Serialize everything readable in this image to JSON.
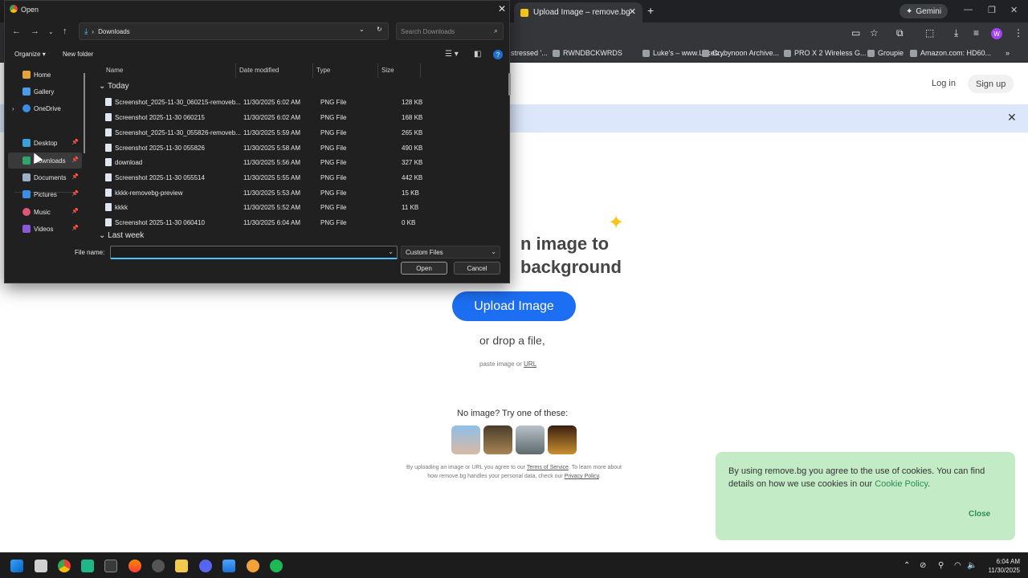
{
  "browser": {
    "tab_title": "Upload Image – remove.bg",
    "new_tab": "+",
    "gemini": "Gemini",
    "bookmarks": [
      "stressed '...",
      "RWNDBCKWRDS",
      "Luke's – www.Lukes....",
      "Crybynoon Archive...",
      "PRO X 2 Wireless G...",
      "Groupie",
      "Amazon.com: HD60..."
    ]
  },
  "page": {
    "login": "Log in",
    "signup": "Sign up",
    "hero_line1": "n image to",
    "hero_line2": "background",
    "upload_button": "Upload Image",
    "drop_text": "or drop a file,",
    "paste_text": "paste image or",
    "paste_link": "URL",
    "no_image_text": "No image? Try one of these:",
    "legal_prefix": "By uploading an image or URL you agree to our",
    "terms_link": "Terms of Service",
    "legal_mid": ". To learn more about how remove.bg handles your personal data, check our",
    "privacy_link": "Privacy Policy",
    "cookie_text": "By using remove.bg you agree to the use of cookies. You can find details on how we use cookies in our",
    "cookie_link": "Cookie Policy",
    "cookie_close": "Close"
  },
  "dialog": {
    "title": "Open",
    "address": "Downloads",
    "search_placeholder": "Search Downloads",
    "organize": "Organize",
    "new_folder": "New folder",
    "nav_items": [
      {
        "label": "Home"
      },
      {
        "label": "Gallery"
      },
      {
        "label": "OneDrive"
      },
      {
        "label": "Desktop"
      },
      {
        "label": "Downloads"
      },
      {
        "label": "Documents"
      },
      {
        "label": "Pictures"
      },
      {
        "label": "Music"
      },
      {
        "label": "Videos"
      }
    ],
    "columns": {
      "name": "Name",
      "date": "Date modified",
      "type": "Type",
      "size": "Size"
    },
    "group_today": "Today",
    "group_last_week": "Last week",
    "files": [
      {
        "name": "Screenshot_2025-11-30_060215-removeb...",
        "date": "11/30/2025 6:02 AM",
        "type": "PNG File",
        "size": "128 KB"
      },
      {
        "name": "Screenshot 2025-11-30 060215",
        "date": "11/30/2025 6:02 AM",
        "type": "PNG File",
        "size": "168 KB"
      },
      {
        "name": "Screenshot_2025-11-30_055826-removeb...",
        "date": "11/30/2025 5:59 AM",
        "type": "PNG File",
        "size": "265 KB"
      },
      {
        "name": "Screenshot 2025-11-30 055826",
        "date": "11/30/2025 5:58 AM",
        "type": "PNG File",
        "size": "490 KB"
      },
      {
        "name": "download",
        "date": "11/30/2025 5:56 AM",
        "type": "PNG File",
        "size": "327 KB"
      },
      {
        "name": "Screenshot 2025-11-30 055514",
        "date": "11/30/2025 5:55 AM",
        "type": "PNG File",
        "size": "442 KB"
      },
      {
        "name": "kkkk-removebg-preview",
        "date": "11/30/2025 5:53 AM",
        "type": "PNG File",
        "size": "15 KB"
      },
      {
        "name": "kkkk",
        "date": "11/30/2025 5:52 AM",
        "type": "PNG File",
        "size": "11 KB"
      },
      {
        "name": "Screenshot 2025-11-30 060410",
        "date": "11/30/2025 6:04 AM",
        "type": "PNG File",
        "size": "0 KB"
      }
    ],
    "file_name_label": "File name:",
    "file_name_value": "",
    "file_type": "Custom Files",
    "open_button": "Open",
    "cancel_button": "Cancel"
  },
  "taskbar": {
    "time": "6:04 AM",
    "date": "11/30/2025"
  }
}
